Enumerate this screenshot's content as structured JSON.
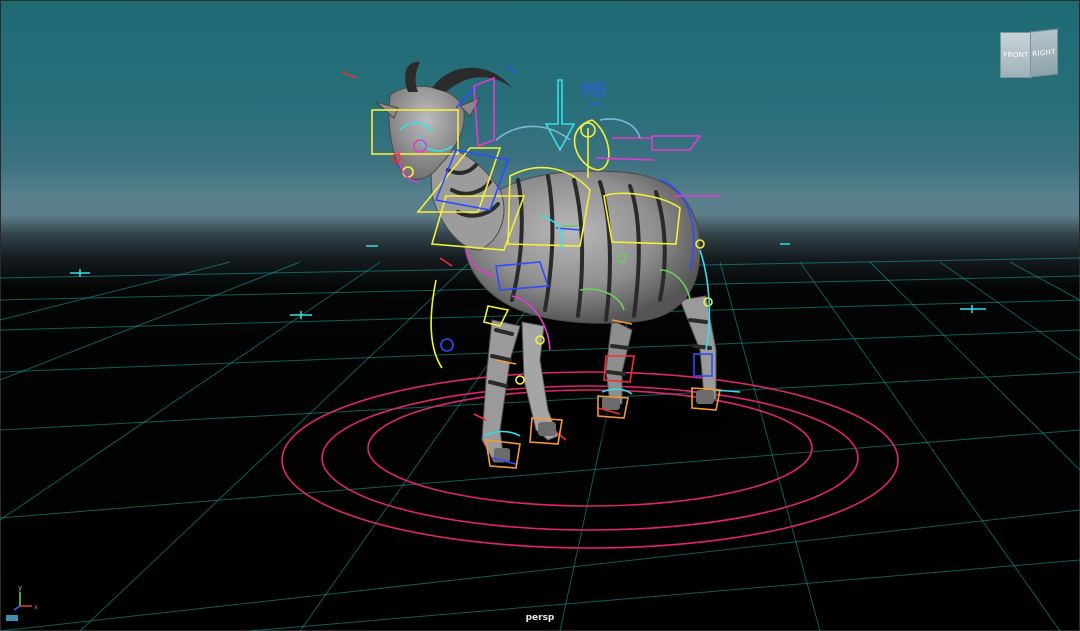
{
  "viewport": {
    "camera_label": "persp"
  },
  "view_cube": {
    "front_label": "FRONT",
    "right_label": "RIGHT"
  },
  "axis_gizmo": {
    "x_label": "x",
    "y_label": "y"
  },
  "scene": {
    "rig_logo_text": "MB",
    "colors": {
      "grid": "#1aa7a0",
      "ground_circles": "#e0246e",
      "rig_yellow": "#f4f03a",
      "rig_blue": "#2f4bff",
      "rig_cyan": "#33e0e8",
      "rig_magenta": "#e23bd0",
      "rig_red": "#f03030",
      "rig_orange": "#f49a3a",
      "rig_green": "#6ad05a",
      "body_gray": "#8d8d8d"
    }
  }
}
